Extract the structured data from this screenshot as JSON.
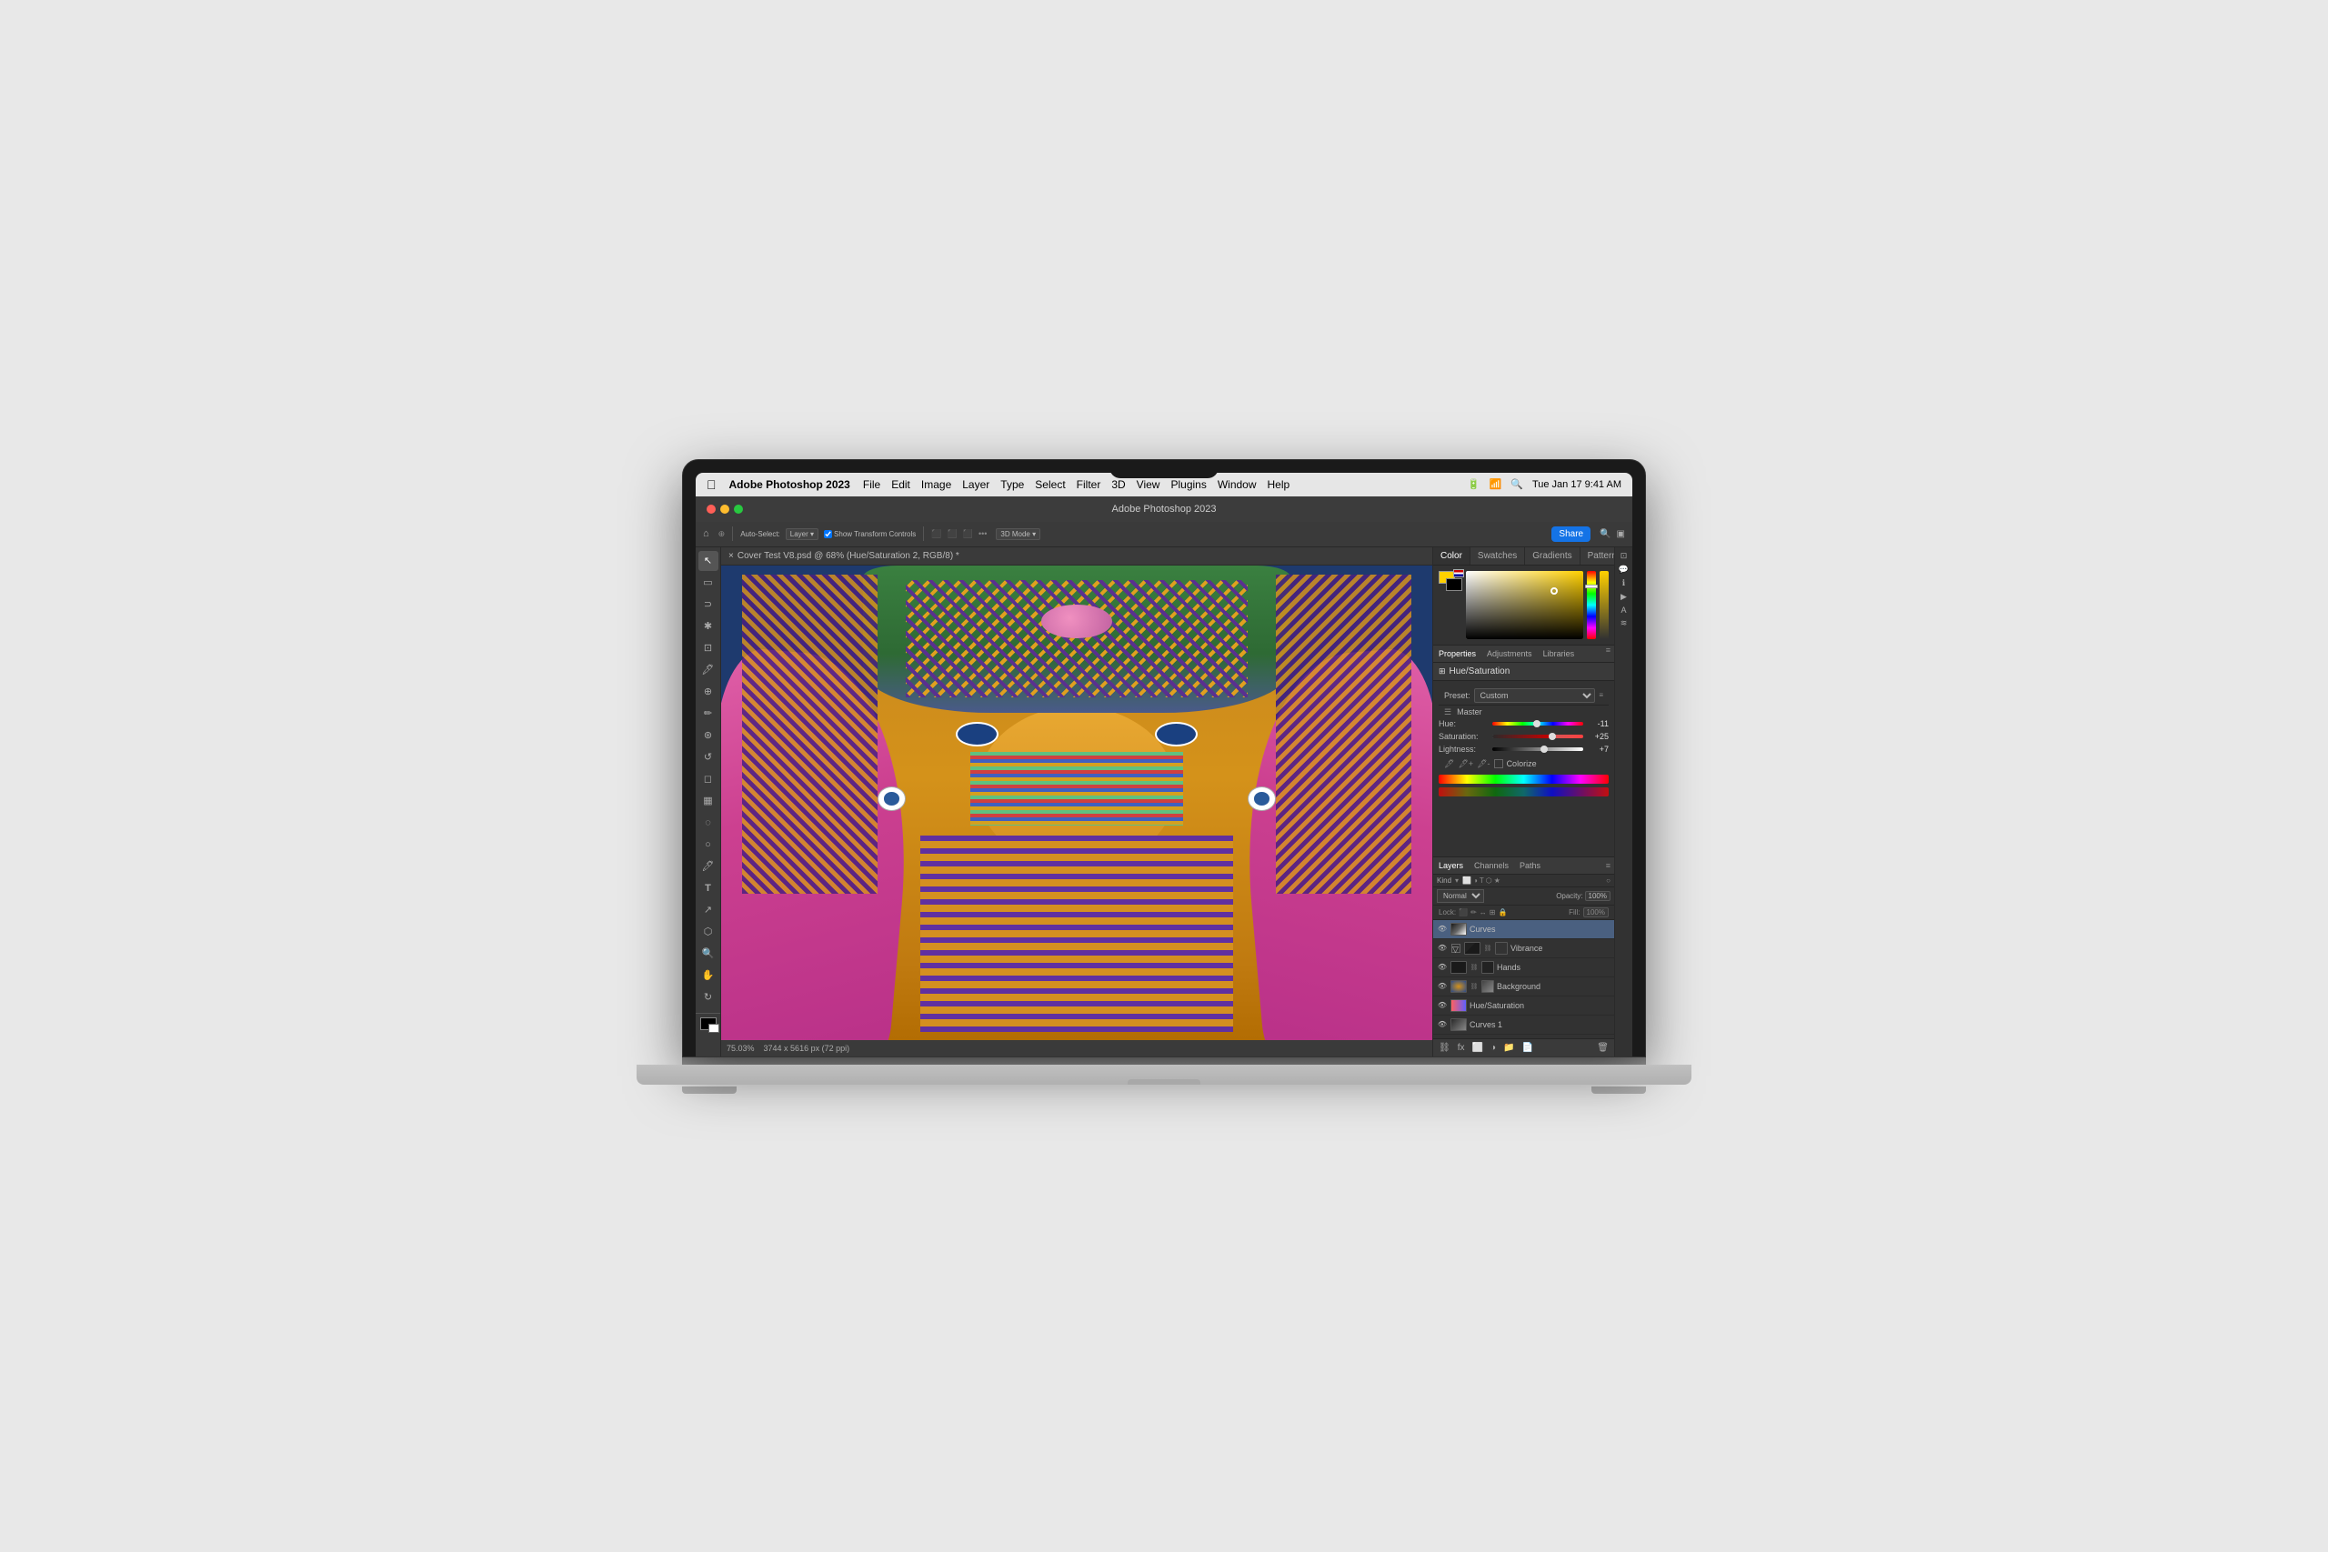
{
  "macos": {
    "menubar": {
      "app_name": "Photoshop",
      "menu_items": [
        "File",
        "Edit",
        "Image",
        "Layer",
        "Type",
        "Select",
        "Filter",
        "3D",
        "View",
        "Plugins",
        "Window",
        "Help"
      ],
      "time": "Tue Jan 17  9:41 AM"
    }
  },
  "photoshop": {
    "title": "Adobe Photoshop 2023",
    "document_tab": "Cover Test V8.psd @ 68% (Hue/Saturation 2, RGB/8) *",
    "status_bar": "75.03%",
    "dimensions": "3744 x 5616 px (72 ppi)",
    "share_btn": "Share",
    "panels": {
      "color": {
        "tabs": [
          "Color",
          "Swatches",
          "Gradients",
          "Patterns"
        ]
      },
      "properties": {
        "tabs": [
          "Properties",
          "Adjustments",
          "Libraries"
        ],
        "adjustment_name": "Hue/Saturation",
        "preset_label": "Preset:",
        "preset_value": "Custom",
        "master_label": "Master",
        "hue_label": "Hue:",
        "hue_value": "-11",
        "saturation_label": "Saturation:",
        "saturation_value": "+25",
        "lightness_label": "Lightness:",
        "lightness_value": "+7",
        "colorize_label": "Colorize"
      },
      "layers": {
        "tabs": [
          "Layers",
          "Channels",
          "Paths"
        ],
        "blend_mode": "Normal",
        "opacity_label": "Opacity:",
        "opacity_value": "100%",
        "fill_label": "Fill:",
        "fill_value": "100%",
        "lock_label": "Lock:",
        "layers": [
          {
            "name": "Curves",
            "visible": true,
            "type": "adjustment",
            "thumb": "curves"
          },
          {
            "name": "Vibrance",
            "visible": true,
            "type": "adjustment",
            "thumb": "vibrance"
          },
          {
            "name": "Hands",
            "visible": true,
            "type": "raster",
            "thumb": "hands"
          },
          {
            "name": "Background",
            "visible": true,
            "type": "raster",
            "thumb": "background"
          },
          {
            "name": "Hue/Saturation",
            "visible": true,
            "type": "adjustment",
            "thumb": "huesat"
          },
          {
            "name": "Curves 1",
            "visible": true,
            "type": "adjustment",
            "thumb": "curves2"
          }
        ]
      }
    }
  }
}
